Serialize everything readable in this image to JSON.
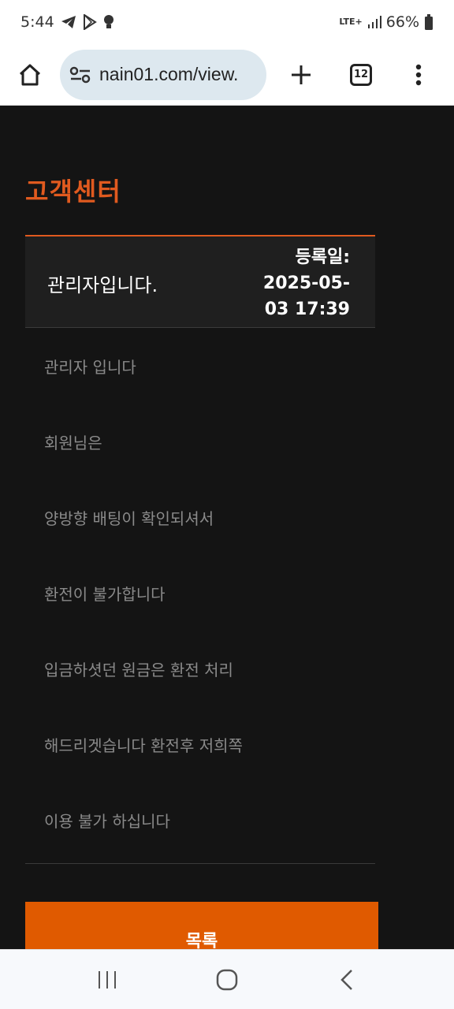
{
  "status_bar": {
    "time": "5:44",
    "network": "LTE+",
    "battery": "66%"
  },
  "browser": {
    "url": "nain01.com/view.",
    "tab_count": "12"
  },
  "page": {
    "section_title": "고객센터",
    "post": {
      "title": "관리자입니다.",
      "date_label": "등록일:",
      "date_value": "2025-05-03 17:39",
      "date_line1": "2025-05-",
      "date_line2": "03 17:39"
    },
    "body_lines": [
      "관리자 입니다",
      "회원님은",
      "양방향 배팅이 확인되셔서",
      "환전이 불가합니다",
      "입금하셧던 원금은 환전 처리",
      "해드리겟습니다 환전후 저희쪽",
      "이용 불가 하십니다"
    ],
    "list_button": "목록"
  },
  "colors": {
    "accent": "#e05a1f",
    "button": "#e05a00",
    "background": "#141414",
    "body_text": "#8a8a8a"
  },
  "icons": {
    "status": [
      "telegram-icon",
      "play-store-icon",
      "lightbulb-icon",
      "signal-icon",
      "battery-icon"
    ],
    "toolbar": [
      "home-icon",
      "site-settings-icon",
      "plus-icon",
      "tab-switcher-icon",
      "more-vert-icon"
    ],
    "nav": [
      "recent-apps-icon",
      "home-circle-icon",
      "back-icon"
    ]
  }
}
